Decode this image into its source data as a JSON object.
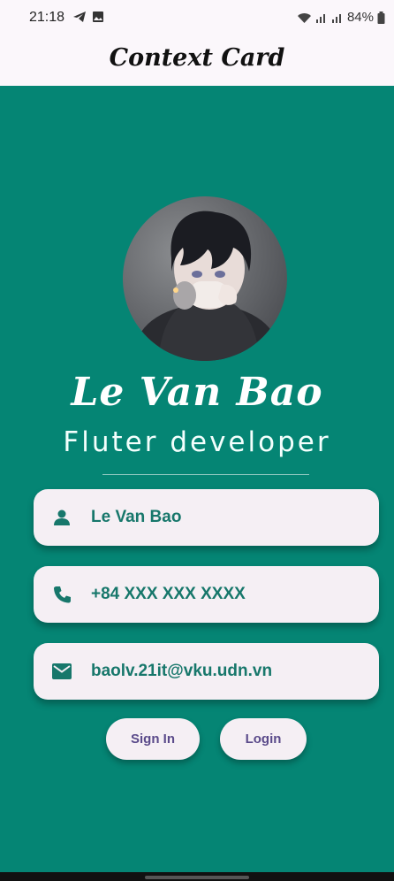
{
  "statusbar": {
    "time": "21:18",
    "battery": "84%"
  },
  "appbar": {
    "title": "Context Card"
  },
  "profile": {
    "name": "Le Van Bao",
    "role": "Fluter developer"
  },
  "cards": [
    {
      "icon": "person-icon",
      "text": "Le Van Bao"
    },
    {
      "icon": "phone-icon",
      "text": "+84 XXX XXX XXXX"
    },
    {
      "icon": "email-icon",
      "text": "baolv.21it@vku.udn.vn"
    }
  ],
  "buttons": {
    "sign_in": "Sign In",
    "login": "Login"
  },
  "colors": {
    "primary": "#058574",
    "card_text": "#17776b",
    "button_text": "#5a4a8a"
  }
}
